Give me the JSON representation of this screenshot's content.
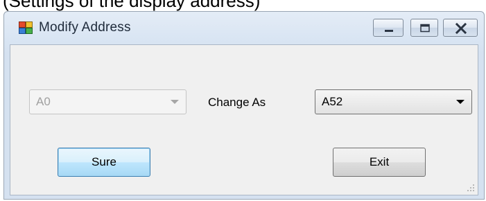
{
  "window": {
    "title": "Modify Address",
    "cropped_top_text": "(Settings of the display address)"
  },
  "form": {
    "current_address": "A0",
    "change_label": "Change As",
    "new_address": "A52"
  },
  "buttons": {
    "sure_label": "Sure",
    "exit_label": "Exit"
  },
  "colors": {
    "client_background": "#f0f0f0",
    "focused_button_border": "#3c7fb1",
    "title_text": "#1e2a3a"
  }
}
